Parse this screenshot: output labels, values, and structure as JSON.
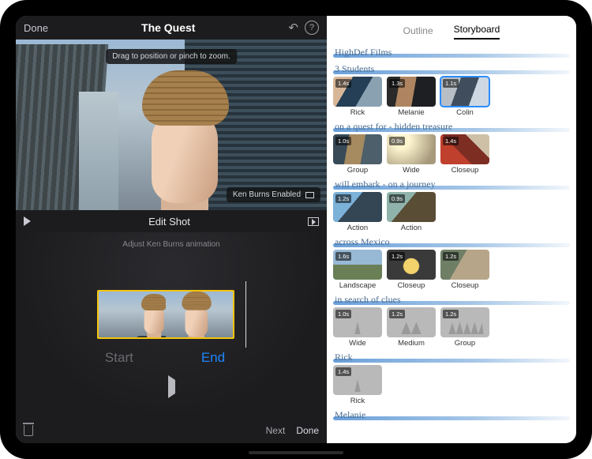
{
  "left": {
    "done": "Done",
    "title": "The Quest",
    "help": "?",
    "previewHint": "Drag to position or pinch to zoom.",
    "kenBurnsBadge": "Ken Burns Enabled",
    "editBarTitle": "Edit Shot",
    "kbCaption": "Adjust Ken Burns animation",
    "startLabel": "Start",
    "endLabel": "End",
    "next": "Next",
    "doneBottom": "Done"
  },
  "tabs": {
    "outline": "Outline",
    "storyboard": "Storyboard"
  },
  "storyboard": {
    "titleLine": "HighDef Films",
    "sections": [
      {
        "heading": "3 Students",
        "clips": [
          {
            "name": "Rick",
            "dur": "1.4s",
            "cls": "th-rick"
          },
          {
            "name": "Melanie",
            "dur": "1.3s",
            "cls": "th-mel"
          },
          {
            "name": "Colin",
            "dur": "1.1s",
            "cls": "th-colin",
            "selected": true
          }
        ]
      },
      {
        "heading": "on a quest for - hidden treasure",
        "clips": [
          {
            "name": "Group",
            "dur": "1.0s",
            "cls": "th-group"
          },
          {
            "name": "Wide",
            "dur": "0.9s",
            "cls": "th-wide"
          },
          {
            "name": "Closeup",
            "dur": "1.4s",
            "cls": "th-close"
          }
        ]
      },
      {
        "heading": "will embark - on a journey",
        "clips": [
          {
            "name": "Action",
            "dur": "1.2s",
            "cls": "th-act1"
          },
          {
            "name": "Action",
            "dur": "0.9s",
            "cls": "th-act2"
          }
        ]
      },
      {
        "heading": "across Mexico",
        "clips": [
          {
            "name": "Landscape",
            "dur": "1.6s",
            "cls": "th-land"
          },
          {
            "name": "Closeup",
            "dur": "1.2s",
            "cls": "th-clu1"
          },
          {
            "name": "Closeup",
            "dur": "1.2s",
            "cls": "th-clu2"
          }
        ]
      },
      {
        "heading": "in search of clues",
        "clips": [
          {
            "name": "Wide",
            "dur": "1.0s",
            "cls": "th-ph th-ph1"
          },
          {
            "name": "Medium",
            "dur": "1.2s",
            "cls": "th-ph th-ph2"
          },
          {
            "name": "Group",
            "dur": "1.2s",
            "cls": "th-ph th-ph4"
          }
        ]
      },
      {
        "heading": "Rick",
        "clips": [
          {
            "name": "Rick",
            "dur": "1.4s",
            "cls": "th-ph th-ph1"
          }
        ]
      },
      {
        "heading": "Melanie",
        "clips": []
      }
    ]
  }
}
